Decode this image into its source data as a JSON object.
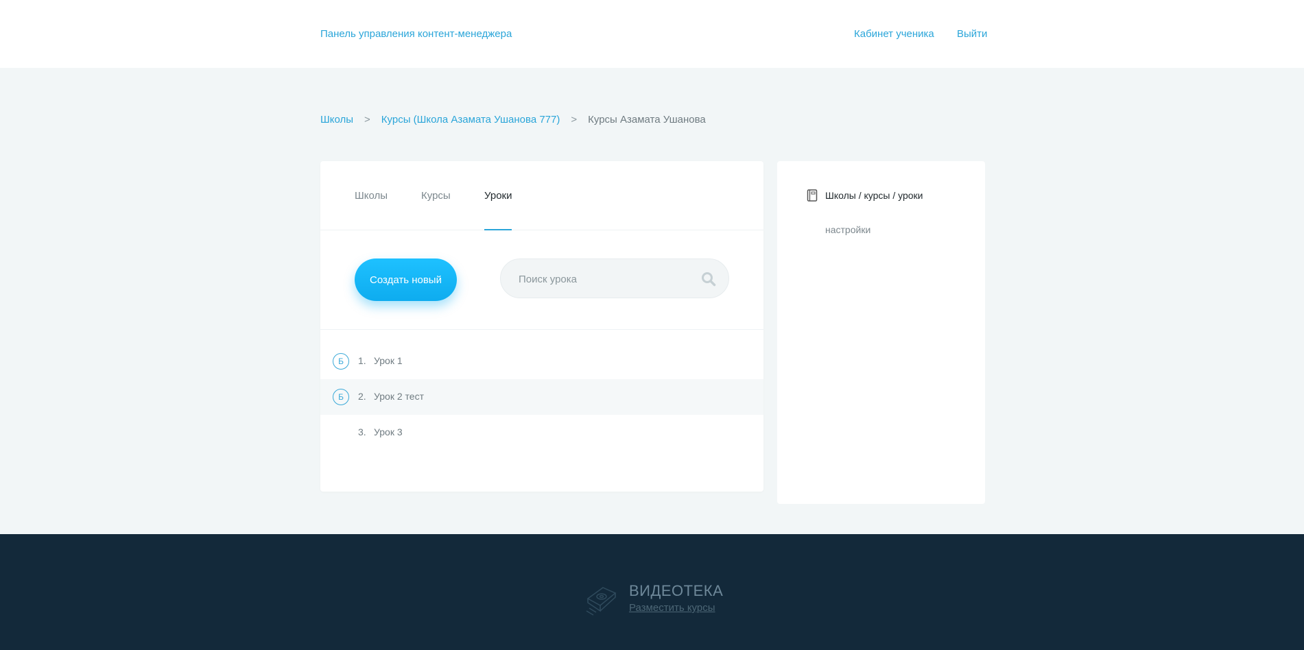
{
  "header": {
    "brand": "Панель управления контент-менеджера",
    "nav_cabinet": "Кабинет ученика",
    "nav_logout": "Выйти"
  },
  "breadcrumb": {
    "items": [
      "Школы",
      "Курсы (Школа Азамата Ушанова 777)",
      "Курсы Азамата Ушанова"
    ],
    "separator": ">"
  },
  "tabs": [
    {
      "label": "Школы",
      "active": false
    },
    {
      "label": "Курсы",
      "active": false
    },
    {
      "label": "Уроки",
      "active": true
    }
  ],
  "toolbar": {
    "create_label": "Создать новый",
    "search_placeholder": "Поиск урока",
    "search_value": ""
  },
  "lessons": [
    {
      "badge": "Б",
      "number": "1.",
      "title": "Урок 1"
    },
    {
      "badge": "Б",
      "number": "2.",
      "title": "Урок 2 тест"
    },
    {
      "badge": "",
      "number": "3.",
      "title": "Урок 3"
    }
  ],
  "sidebar": {
    "title": "Школы / курсы / уроки",
    "settings": "настройки"
  },
  "footer": {
    "logo_text": "ВИДЕОТЕКА",
    "link": "Разместить курсы"
  },
  "colors": {
    "accent": "#2aa5d9",
    "button": "#13b6f6",
    "footer_bg": "#13293a",
    "page_bg": "#f2f6f7"
  },
  "icons": [
    "search-icon",
    "book-icon",
    "videoteka-logo-icon"
  ]
}
